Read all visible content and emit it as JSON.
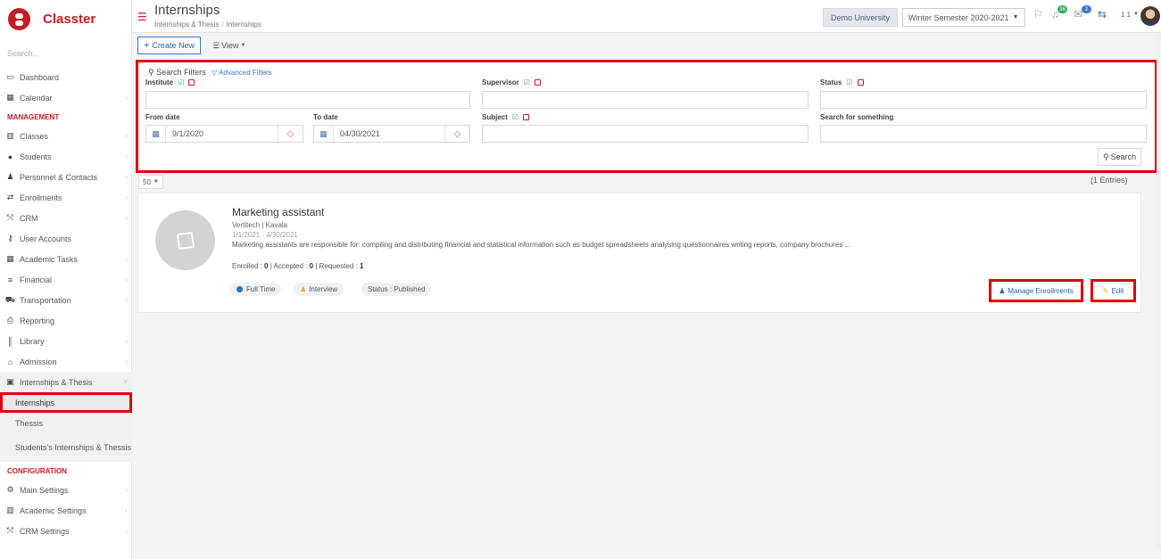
{
  "app": {
    "name": "Classter"
  },
  "sidebar": {
    "search_placeholder": "Search...",
    "dashboard": "Dashboard",
    "calendar": "Calendar",
    "management_heading": "MANAGEMENT",
    "management_items": [
      "Classes",
      "Students",
      "Personnel & Contacts",
      "Enrollments",
      "CRM",
      "User Accounts",
      "Academic Tasks",
      "Financial",
      "Transportation",
      "Reporting",
      "Library",
      "Admission"
    ],
    "internships_group": "Internships & Thesis",
    "internships_sub": [
      "Internships",
      "Thessis",
      "Students's Internships & Thessis"
    ],
    "configuration_heading": "CONFIGURATION",
    "configuration_items": [
      "Main Settings",
      "Academic Settings",
      "CRM Settings"
    ]
  },
  "header": {
    "title": "Internships",
    "breadcrumb": [
      "Internships & Thesis",
      "Internships"
    ],
    "university": "Demo University",
    "semester": "Winter Semester 2020-2021",
    "badge_notifications": "36",
    "badge_messages": "2",
    "user_count": "1 1"
  },
  "toolbar": {
    "create_label": "Create New",
    "view_label": "View"
  },
  "filters": {
    "title": "Search Filters",
    "advanced": "Advanced Filters",
    "institute": "Institute",
    "supervisor": "Supervisor",
    "status": "Status",
    "from_date_label": "From date",
    "from_date_value": "9/1/2020",
    "to_date_label": "To date",
    "to_date_value": "04/30/2021",
    "subject": "Subject",
    "search_something": "Search for something",
    "search_button": "Search"
  },
  "results": {
    "page_size": "50",
    "entries": "(1 Entries)",
    "card": {
      "title": "Marketing assistant",
      "company": "Vertitech | Kavala",
      "dates": "1/1/2021 - 4/30/2021",
      "description": "Marketing assistants are responsible for: compiling and distributing financial and statistical information such as budget spreadsheets analysing questionnaires writing reports, company brochures ...",
      "enrolled_label": "Enrolled :",
      "enrolled": "0",
      "accepted_label": "Accepted :",
      "accepted": "0",
      "requested_label": "Requested :",
      "requested": "1",
      "tags": [
        "Full Time",
        "Interview",
        "Status : Published"
      ],
      "manage_label": "Manage Enrollments",
      "edit_label": "Edit"
    }
  },
  "colors": {
    "brand": "#c41e24",
    "accent": "#2a62b0",
    "highlight": "#e0000f"
  }
}
